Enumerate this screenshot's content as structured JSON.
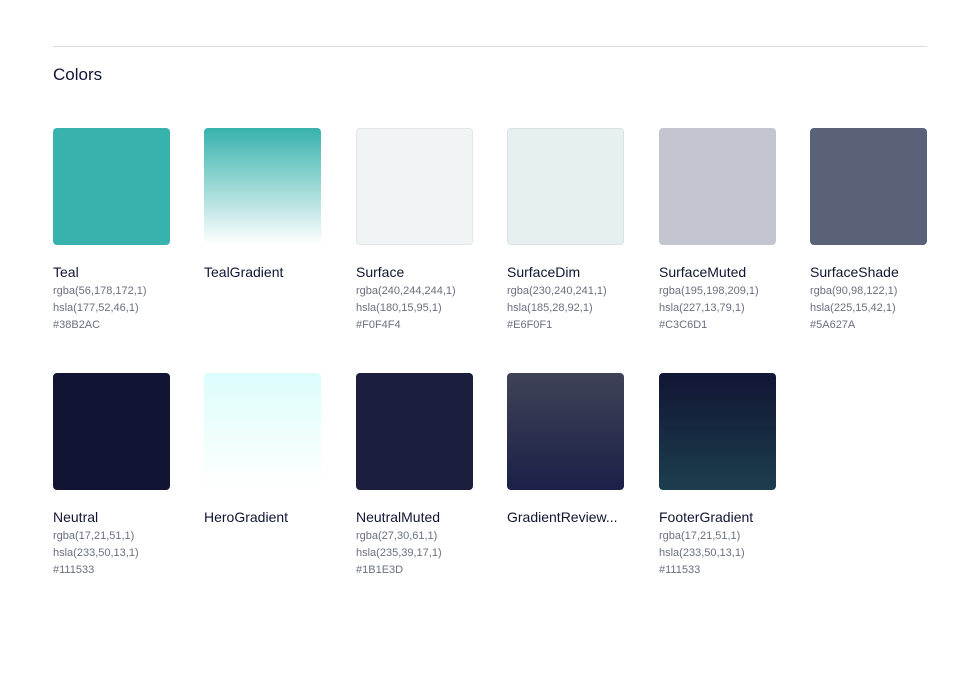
{
  "section": {
    "title": "Colors"
  },
  "swatches": [
    {
      "name": "Teal",
      "rgba": "rgba(56,178,172,1)",
      "hsla": "hsla(177,52,46,1)",
      "hex": "#38B2AC",
      "fill": "#38B2AC"
    },
    {
      "name": "TealGradient",
      "rgba": "",
      "hsla": "",
      "hex": "",
      "fill": "linear-gradient(180deg, #38B2AC 0%, #ffffff 100%)"
    },
    {
      "name": "Surface",
      "rgba": "rgba(240,244,244,1)",
      "hsla": "hsla(180,15,95,1)",
      "hex": "#F0F4F4",
      "fill": "#F0F4F4"
    },
    {
      "name": "SurfaceDim",
      "rgba": "rgba(230,240,241,1)",
      "hsla": "hsla(185,28,92,1)",
      "hex": "#E6F0F1",
      "fill": "#E6F0F1"
    },
    {
      "name": "SurfaceMuted",
      "rgba": "rgba(195,198,209,1)",
      "hsla": "hsla(227,13,79,1)",
      "hex": "#C3C6D1",
      "fill": "#C3C6D1"
    },
    {
      "name": "SurfaceShade",
      "rgba": "rgba(90,98,122,1)",
      "hsla": "hsla(225,15,42,1)",
      "hex": "#5A627A",
      "fill": "#5A627A"
    },
    {
      "name": "Neutral",
      "rgba": "rgba(17,21,51,1)",
      "hsla": "hsla(233,50,13,1)",
      "hex": "#111533",
      "fill": "#111533"
    },
    {
      "name": "HeroGradient",
      "rgba": "",
      "hsla": "",
      "hex": "",
      "fill": "linear-gradient(180deg, #DCFDFB 0%, #ffffff 100%)"
    },
    {
      "name": "NeutralMuted",
      "rgba": "rgba(27,30,61,1)",
      "hsla": "hsla(235,39,17,1)",
      "hex": "#1B1E3D",
      "fill": "#1B1E3D"
    },
    {
      "name": "GradientReview...",
      "rgba": "",
      "hsla": "",
      "hex": "",
      "fill": "linear-gradient(180deg, #3F4257 0%, #1B2147 100%)"
    },
    {
      "name": "FooterGradient",
      "rgba": "rgba(17,21,51,1)",
      "hsla": "hsla(233,50,13,1)",
      "hex": "#111533",
      "fill": "linear-gradient(180deg, #111533 0%, #1C3E4E 100%)"
    }
  ]
}
